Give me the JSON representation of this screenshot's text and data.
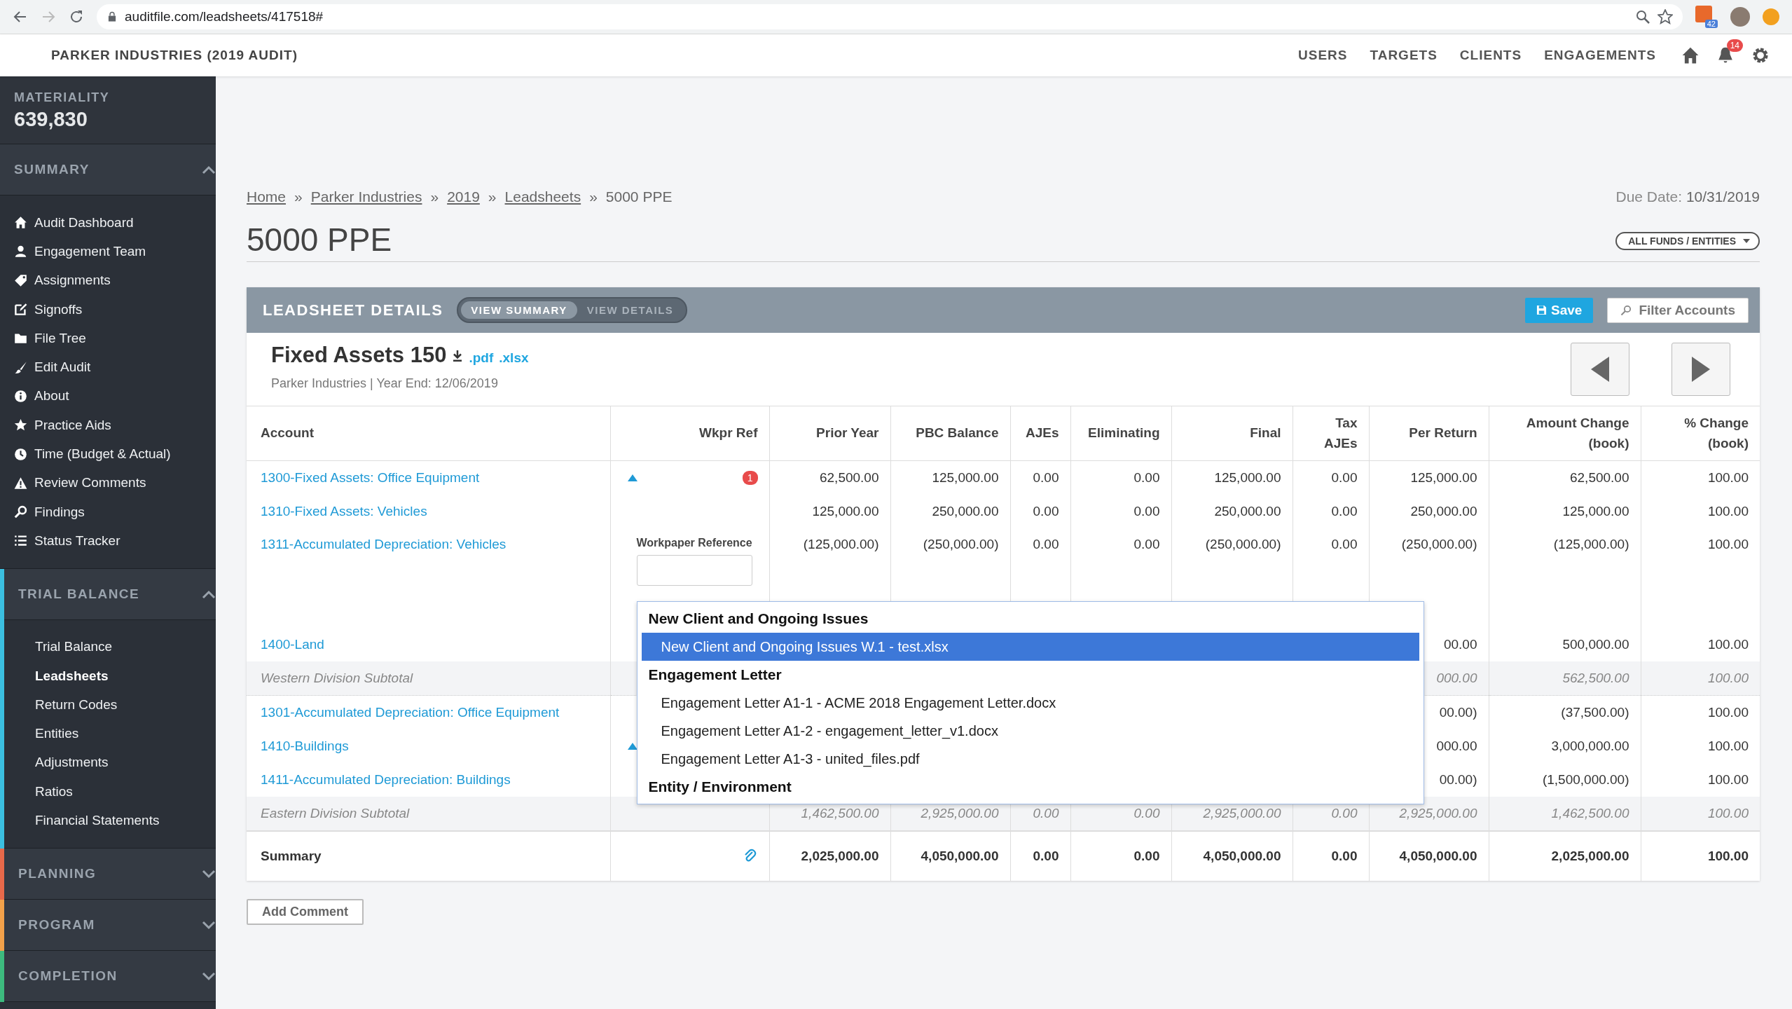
{
  "browser": {
    "url": "auditfile.com/leadsheets/417518#",
    "extension_badge": "42"
  },
  "header": {
    "title": "PARKER INDUSTRIES (2019 AUDIT)",
    "nav": [
      "USERS",
      "TARGETS",
      "CLIENTS",
      "ENGAGEMENTS"
    ],
    "notification_count": "14"
  },
  "sidebar": {
    "materiality": {
      "label": "MATERIALITY",
      "value": "639,830"
    },
    "sections": [
      {
        "title": "SUMMARY",
        "expanded": true,
        "items": [
          {
            "label": "Audit Dashboard",
            "selected": false
          },
          {
            "label": "Engagement Team",
            "selected": false
          },
          {
            "label": "Assignments",
            "selected": false
          },
          {
            "label": "Signoffs",
            "selected": false
          },
          {
            "label": "File Tree",
            "selected": false
          },
          {
            "label": "Edit Audit",
            "selected": false
          },
          {
            "label": "About",
            "selected": false
          },
          {
            "label": "Practice Aids",
            "selected": false
          },
          {
            "label": "Time (Budget & Actual)",
            "selected": false
          },
          {
            "label": "Review Comments",
            "selected": false
          },
          {
            "label": "Findings",
            "selected": false
          },
          {
            "label": "Status Tracker",
            "selected": false
          }
        ]
      },
      {
        "title": "TRIAL BALANCE",
        "expanded": true,
        "color": "#3bbfe0",
        "items": [
          {
            "label": "Trial Balance",
            "selected": false
          },
          {
            "label": "Leadsheets",
            "selected": true
          },
          {
            "label": "Return Codes",
            "selected": false
          },
          {
            "label": "Entities",
            "selected": false
          },
          {
            "label": "Adjustments",
            "selected": false
          },
          {
            "label": "Ratios",
            "selected": false
          },
          {
            "label": "Financial Statements",
            "selected": false
          }
        ]
      },
      {
        "title": "PLANNING",
        "expanded": false,
        "color": "#e8694a"
      },
      {
        "title": "PROGRAM",
        "expanded": false,
        "color": "#f2a14a"
      },
      {
        "title": "COMPLETION",
        "expanded": false,
        "color": "#3dba7e"
      }
    ]
  },
  "breadcrumb": {
    "separator": "»",
    "links": [
      "Home",
      "Parker Industries",
      "2019",
      "Leadsheets"
    ],
    "current": "5000 PPE"
  },
  "due_date": {
    "label": "Due Date:",
    "value": "10/31/2019"
  },
  "page_title": "5000 PPE",
  "funds_filter": "ALL FUNDS / ENTITIES",
  "panel": {
    "title": "LEADSHEET DETAILS",
    "views": [
      {
        "label": "VIEW SUMMARY",
        "selected": true
      },
      {
        "label": "VIEW DETAILS",
        "selected": false
      }
    ],
    "save": "Save",
    "filter": "Filter Accounts",
    "sheet_title": "Fixed Assets 150",
    "downloads": [
      ".pdf",
      ".xlsx"
    ],
    "subtitle": "Parker Industries | Year End: 12/06/2019"
  },
  "table": {
    "columns": [
      {
        "lines": [
          "Account"
        ]
      },
      {
        "lines": [
          "Wkpr Ref"
        ]
      },
      {
        "lines": [
          "Prior Year"
        ]
      },
      {
        "lines": [
          "PBC Balance"
        ]
      },
      {
        "lines": [
          "AJEs"
        ]
      },
      {
        "lines": [
          "Eliminating"
        ]
      },
      {
        "lines": [
          "Final"
        ]
      },
      {
        "lines": [
          "Tax",
          "AJEs"
        ]
      },
      {
        "lines": [
          "Per Return"
        ]
      },
      {
        "lines": [
          "Amount Change",
          "(book)"
        ]
      },
      {
        "lines": [
          "% Change",
          "(book)"
        ]
      }
    ],
    "rows": [
      {
        "kind": "account",
        "account": "1300-Fixed Assets: Office Equipment",
        "wkpr": {
          "marker": true,
          "badge": "1"
        },
        "values": [
          "62,500.00",
          "125,000.00",
          "0.00",
          "0.00",
          "125,000.00",
          "0.00",
          "125,000.00",
          "62,500.00",
          "100.00"
        ]
      },
      {
        "kind": "account",
        "account": "1310-Fixed Assets: Vehicles",
        "wkpr": {},
        "values": [
          "125,000.00",
          "250,000.00",
          "0.00",
          "0.00",
          "250,000.00",
          "0.00",
          "250,000.00",
          "125,000.00",
          "100.00"
        ]
      },
      {
        "kind": "account",
        "account": "1311-Accumulated Depreciation: Vehicles",
        "wkpr": {
          "editor": {
            "label": "Workpaper Reference",
            "dropdown": [
              {
                "title": "New Client and Ongoing Issues",
                "options": [
                  {
                    "label": "New Client and Ongoing Issues W.1 - test.xlsx",
                    "selected": true
                  }
                ]
              },
              {
                "title": "Engagement Letter",
                "options": [
                  {
                    "label": "Engagement Letter A1-1 - ACME 2018 Engagement Letter.docx",
                    "selected": false
                  },
                  {
                    "label": "Engagement Letter A1-2 - engagement_letter_v1.docx",
                    "selected": false
                  },
                  {
                    "label": "Engagement Letter A1-3 - united_files.pdf",
                    "selected": false
                  }
                ]
              },
              {
                "title": "Entity / Environment"
              }
            ]
          }
        },
        "values": [
          "(125,000.00)",
          "(250,000.00)",
          "0.00",
          "0.00",
          "(250,000.00)",
          "0.00",
          "(250,000.00)",
          "(125,000.00)",
          "100.00"
        ]
      },
      {
        "kind": "account",
        "account": "1400-Land",
        "covered": true,
        "values": [
          "00.00",
          "500,000.00",
          "100.00"
        ]
      },
      {
        "kind": "subtotal",
        "account": "Western Division Subtotal",
        "covered": true,
        "values": [
          "000.00",
          "562,500.00",
          "100.00"
        ]
      },
      {
        "kind": "account",
        "account": "1301-Accumulated Depreciation: Office Equipment",
        "covered": true,
        "values": [
          "00.00)",
          "(37,500.00)",
          "100.00"
        ]
      },
      {
        "kind": "account",
        "account": "1410-Buildings",
        "covered": true,
        "wkpr": {
          "marker": true
        },
        "values": [
          "000.00",
          "3,000,000.00",
          "100.00"
        ]
      },
      {
        "kind": "account",
        "account": "1411-Accumulated Depreciation: Buildings",
        "covered": true,
        "values": [
          "00.00)",
          "(1,500,000.00)",
          "100.00"
        ]
      },
      {
        "kind": "subtotal",
        "account": "Eastern Division Subtotal",
        "values": [
          "1,462,500.00",
          "2,925,000.00",
          "0.00",
          "0.00",
          "2,925,000.00",
          "0.00",
          "2,925,000.00",
          "1,462,500.00",
          "100.00"
        ]
      },
      {
        "kind": "summary",
        "account": "Summary",
        "wkpr": {
          "attachment": true
        },
        "values": [
          "2,025,000.00",
          "4,050,000.00",
          "0.00",
          "0.00",
          "4,050,000.00",
          "0.00",
          "4,050,000.00",
          "2,025,000.00",
          "100.00"
        ]
      }
    ]
  },
  "add_comment": "Add Comment"
}
